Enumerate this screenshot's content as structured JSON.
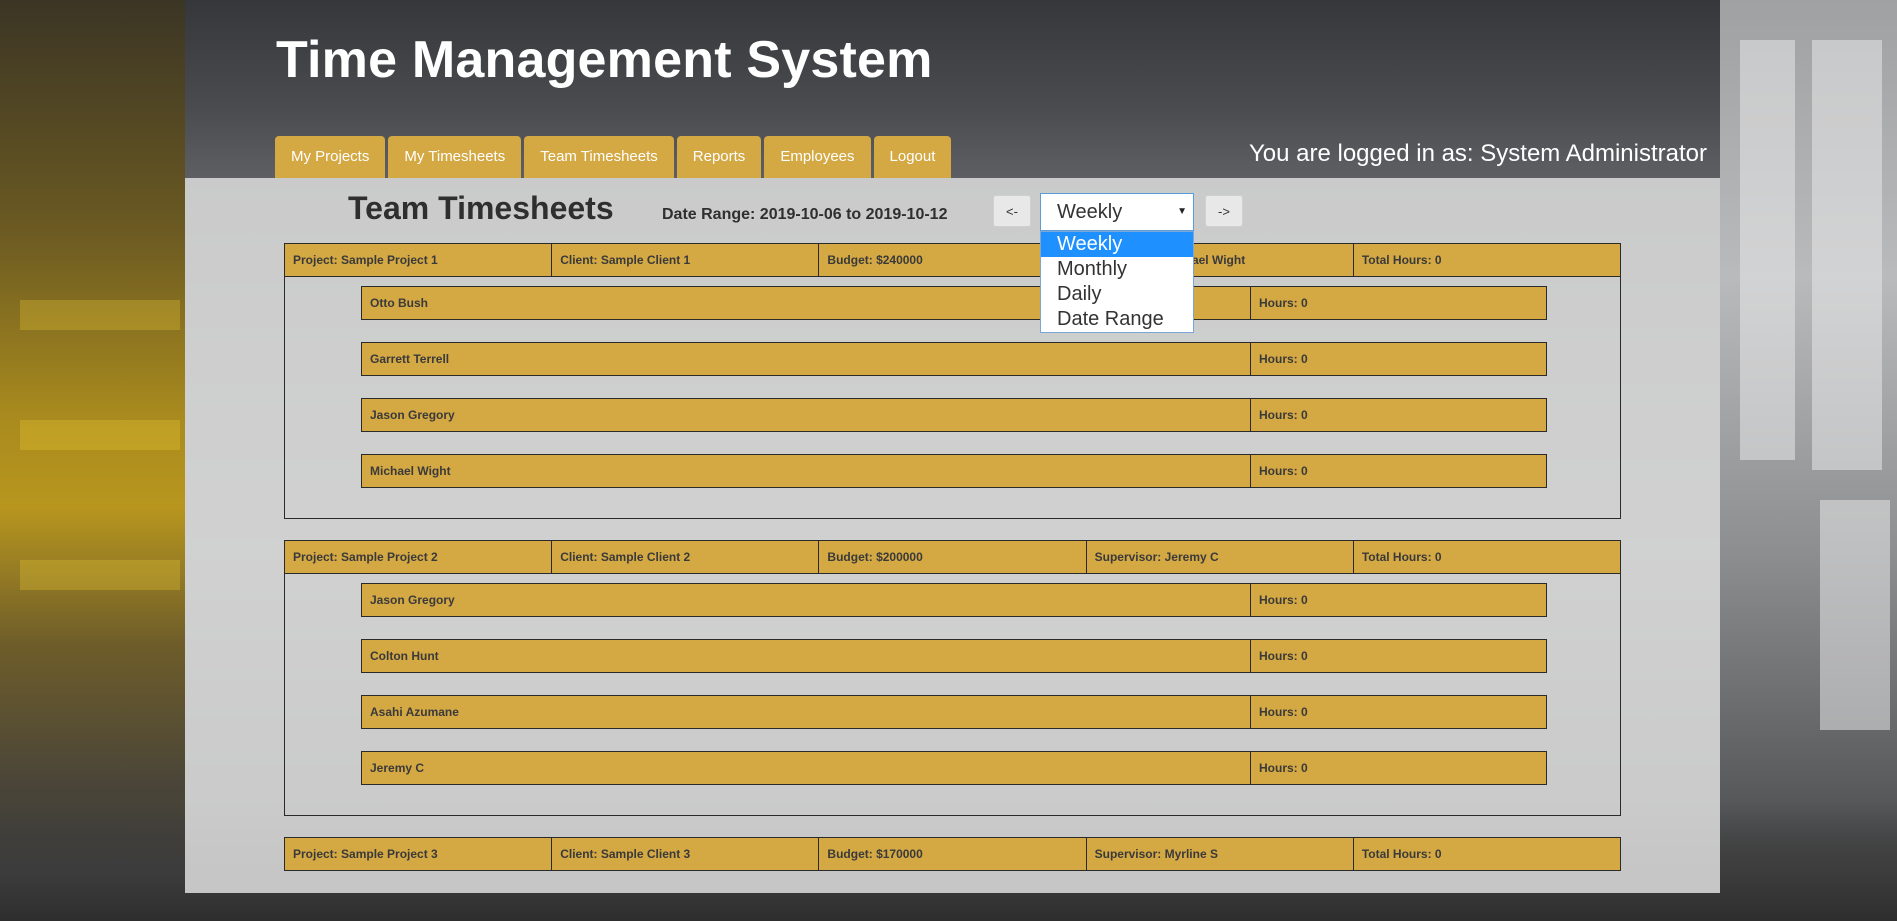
{
  "app": {
    "title": "Time Management System",
    "login_text": "You are logged in as: System Administrator"
  },
  "nav": {
    "tabs": [
      {
        "label": "My Projects"
      },
      {
        "label": "My Timesheets"
      },
      {
        "label": "Team Timesheets"
      },
      {
        "label": "Reports"
      },
      {
        "label": "Employees"
      },
      {
        "label": "Logout"
      }
    ]
  },
  "page": {
    "title": "Team Timesheets",
    "date_range": "Date Range: 2019-10-06 to 2019-10-12",
    "prev_label": "<-",
    "next_label": "->",
    "period_select": {
      "selected": "Weekly",
      "options": [
        "Weekly",
        "Monthly",
        "Daily",
        "Date Range"
      ]
    }
  },
  "projects": [
    {
      "project": "Project: Sample Project 1",
      "client": "Client: Sample Client 1",
      "budget": "Budget: $240000",
      "supervisor": "Supervisor: Michael Wight",
      "total": "Total Hours: 0",
      "employees": [
        {
          "name": "Otto Bush",
          "hours": "Hours: 0"
        },
        {
          "name": "Garrett Terrell",
          "hours": "Hours: 0"
        },
        {
          "name": "Jason Gregory",
          "hours": "Hours: 0"
        },
        {
          "name": "Michael Wight",
          "hours": "Hours: 0"
        }
      ]
    },
    {
      "project": "Project: Sample Project 2",
      "client": "Client: Sample Client 2",
      "budget": "Budget: $200000",
      "supervisor": "Supervisor: Jeremy C",
      "total": "Total Hours: 0",
      "employees": [
        {
          "name": "Jason Gregory",
          "hours": "Hours: 0"
        },
        {
          "name": "Colton Hunt",
          "hours": "Hours: 0"
        },
        {
          "name": "Asahi Azumane",
          "hours": "Hours: 0"
        },
        {
          "name": "Jeremy C",
          "hours": "Hours: 0"
        }
      ]
    },
    {
      "project": "Project: Sample Project 3",
      "client": "Client: Sample Client 3",
      "budget": "Budget: $170000",
      "supervisor": "Supervisor: Myrline S",
      "total": "Total Hours: 0",
      "employees": []
    }
  ],
  "colors": {
    "accent": "#d4a843",
    "select_highlight": "#1e90ff"
  }
}
